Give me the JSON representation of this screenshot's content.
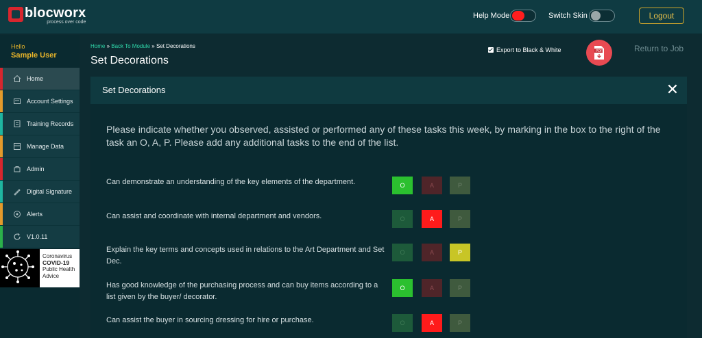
{
  "brand": {
    "name": "blocworx",
    "tagline": "process over code"
  },
  "topbar": {
    "help_mode_label": "Help Mode",
    "switch_skin_label": "Switch Skin",
    "logout_label": "Logout"
  },
  "sidebar": {
    "greeting": "Hello",
    "user": "Sample User",
    "items": [
      {
        "label": "Home",
        "icon": "home-icon",
        "color": "#d7262e"
      },
      {
        "label": "Account Settings",
        "icon": "settings-icon",
        "color": "#e39a2b"
      },
      {
        "label": "Training Records",
        "icon": "training-icon",
        "color": "#1fb5a0"
      },
      {
        "label": "Manage Data",
        "icon": "data-icon",
        "color": "#e39a2b"
      },
      {
        "label": "Admin",
        "icon": "admin-icon",
        "color": "#d7262e"
      },
      {
        "label": "Digital Signature",
        "icon": "signature-icon",
        "color": "#1fb5a0"
      },
      {
        "label": "Alerts",
        "icon": "alerts-icon",
        "color": "#e39a2b"
      },
      {
        "label": "V1.0.11",
        "icon": "refresh-icon",
        "color": "#2bb04a"
      }
    ],
    "covid": {
      "line1": "Coronavirus",
      "line2": "COVID-19",
      "line3": "Public Health",
      "line4": "Advice"
    }
  },
  "breadcrumb": {
    "home": "Home",
    "sep1": " » ",
    "back": "Back To Module",
    "sep2": " » ",
    "current": "Set Decorations"
  },
  "page": {
    "title": "Set Decorations",
    "export_label": "Export to Black & White",
    "return_label": "Return to Job"
  },
  "panel": {
    "title": "Set Decorations",
    "close": "✕",
    "instructions": "Please indicate whether you observed, assisted or performed any of these tasks this week, by marking in the box to the right of the task an O, A, P. Please add any additional tasks to the end of the list.",
    "options": {
      "o": "O",
      "a": "A",
      "p": "P"
    },
    "tasks": [
      {
        "text": "Can demonstrate an understanding of the key elements of the department.",
        "selected": "O"
      },
      {
        "text": "Can assist and coordinate with internal department and vendors.",
        "selected": "A"
      },
      {
        "text": "Explain the key terms and concepts used in relations to the Art Department and Set Dec.",
        "selected": "P"
      },
      {
        "text": "Has good knowledge of the purchasing process and can buy items according to a list given by the buyer/ decorator.",
        "selected": "O"
      },
      {
        "text": "Can assist the buyer in sourcing dressing for hire or purchase.",
        "selected": "A"
      }
    ]
  },
  "colors": {
    "background": "#0d2b31",
    "accent_gold": "#e9b52a",
    "link_green": "#2fd6a9",
    "observed": "#2bc02f",
    "assisted": "#ff1b1b",
    "performed": "#c8c526"
  }
}
